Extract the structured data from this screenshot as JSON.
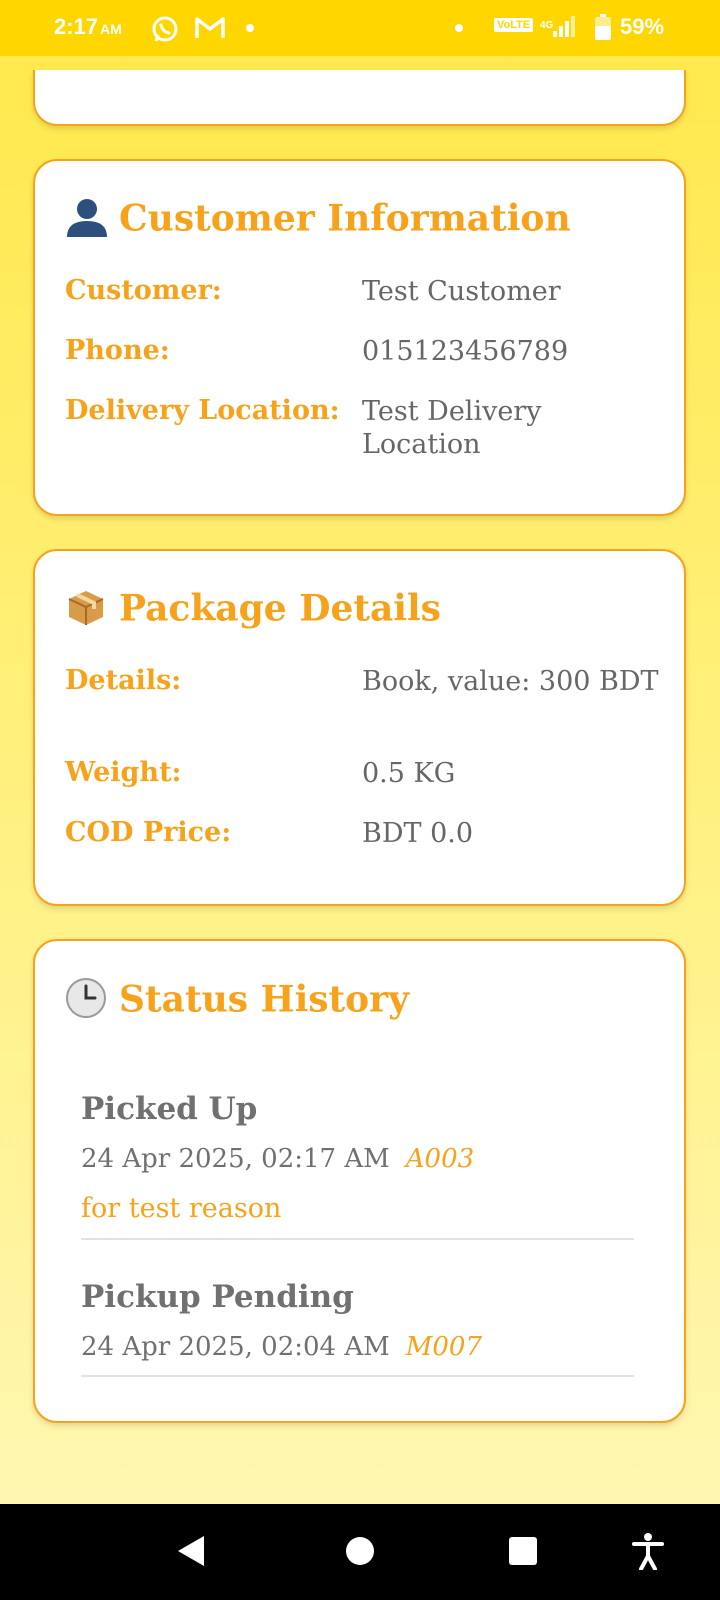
{
  "status_bar": {
    "time": "2:17",
    "ampm": "AM",
    "network_label": "VoLTE",
    "network_type": "4G",
    "battery": "59%"
  },
  "customer_info": {
    "icon": "person-emoji",
    "title": "Customer Information",
    "rows": [
      {
        "label": "Customer:",
        "value": "Test Customer"
      },
      {
        "label": "Phone:",
        "value": "015123456789"
      },
      {
        "label": "Delivery Location:",
        "value": "Test Delivery Location"
      }
    ]
  },
  "package_details": {
    "icon": "package-emoji",
    "title": "Package Details",
    "rows": [
      {
        "label": "Details:",
        "value": "Book, value: 300 BDT"
      },
      {
        "label": "Weight:",
        "value": "0.5 KG"
      },
      {
        "label": "COD Price:",
        "value": "BDT 0.0"
      }
    ]
  },
  "status_history": {
    "icon": "clock-emoji",
    "title": "Status History",
    "entries": [
      {
        "status": "Picked Up",
        "time": "24 Apr 2025, 02:17 AM",
        "user": "A003",
        "reason": "for test reason"
      },
      {
        "status": "Pickup Pending",
        "time": "24 Apr 2025, 02:04 AM",
        "user": "M007"
      }
    ]
  },
  "colors": {
    "accent": "#F7A21B",
    "status_bar": "#FFD600",
    "background": "#FFE84A",
    "text_value": "#666666"
  }
}
